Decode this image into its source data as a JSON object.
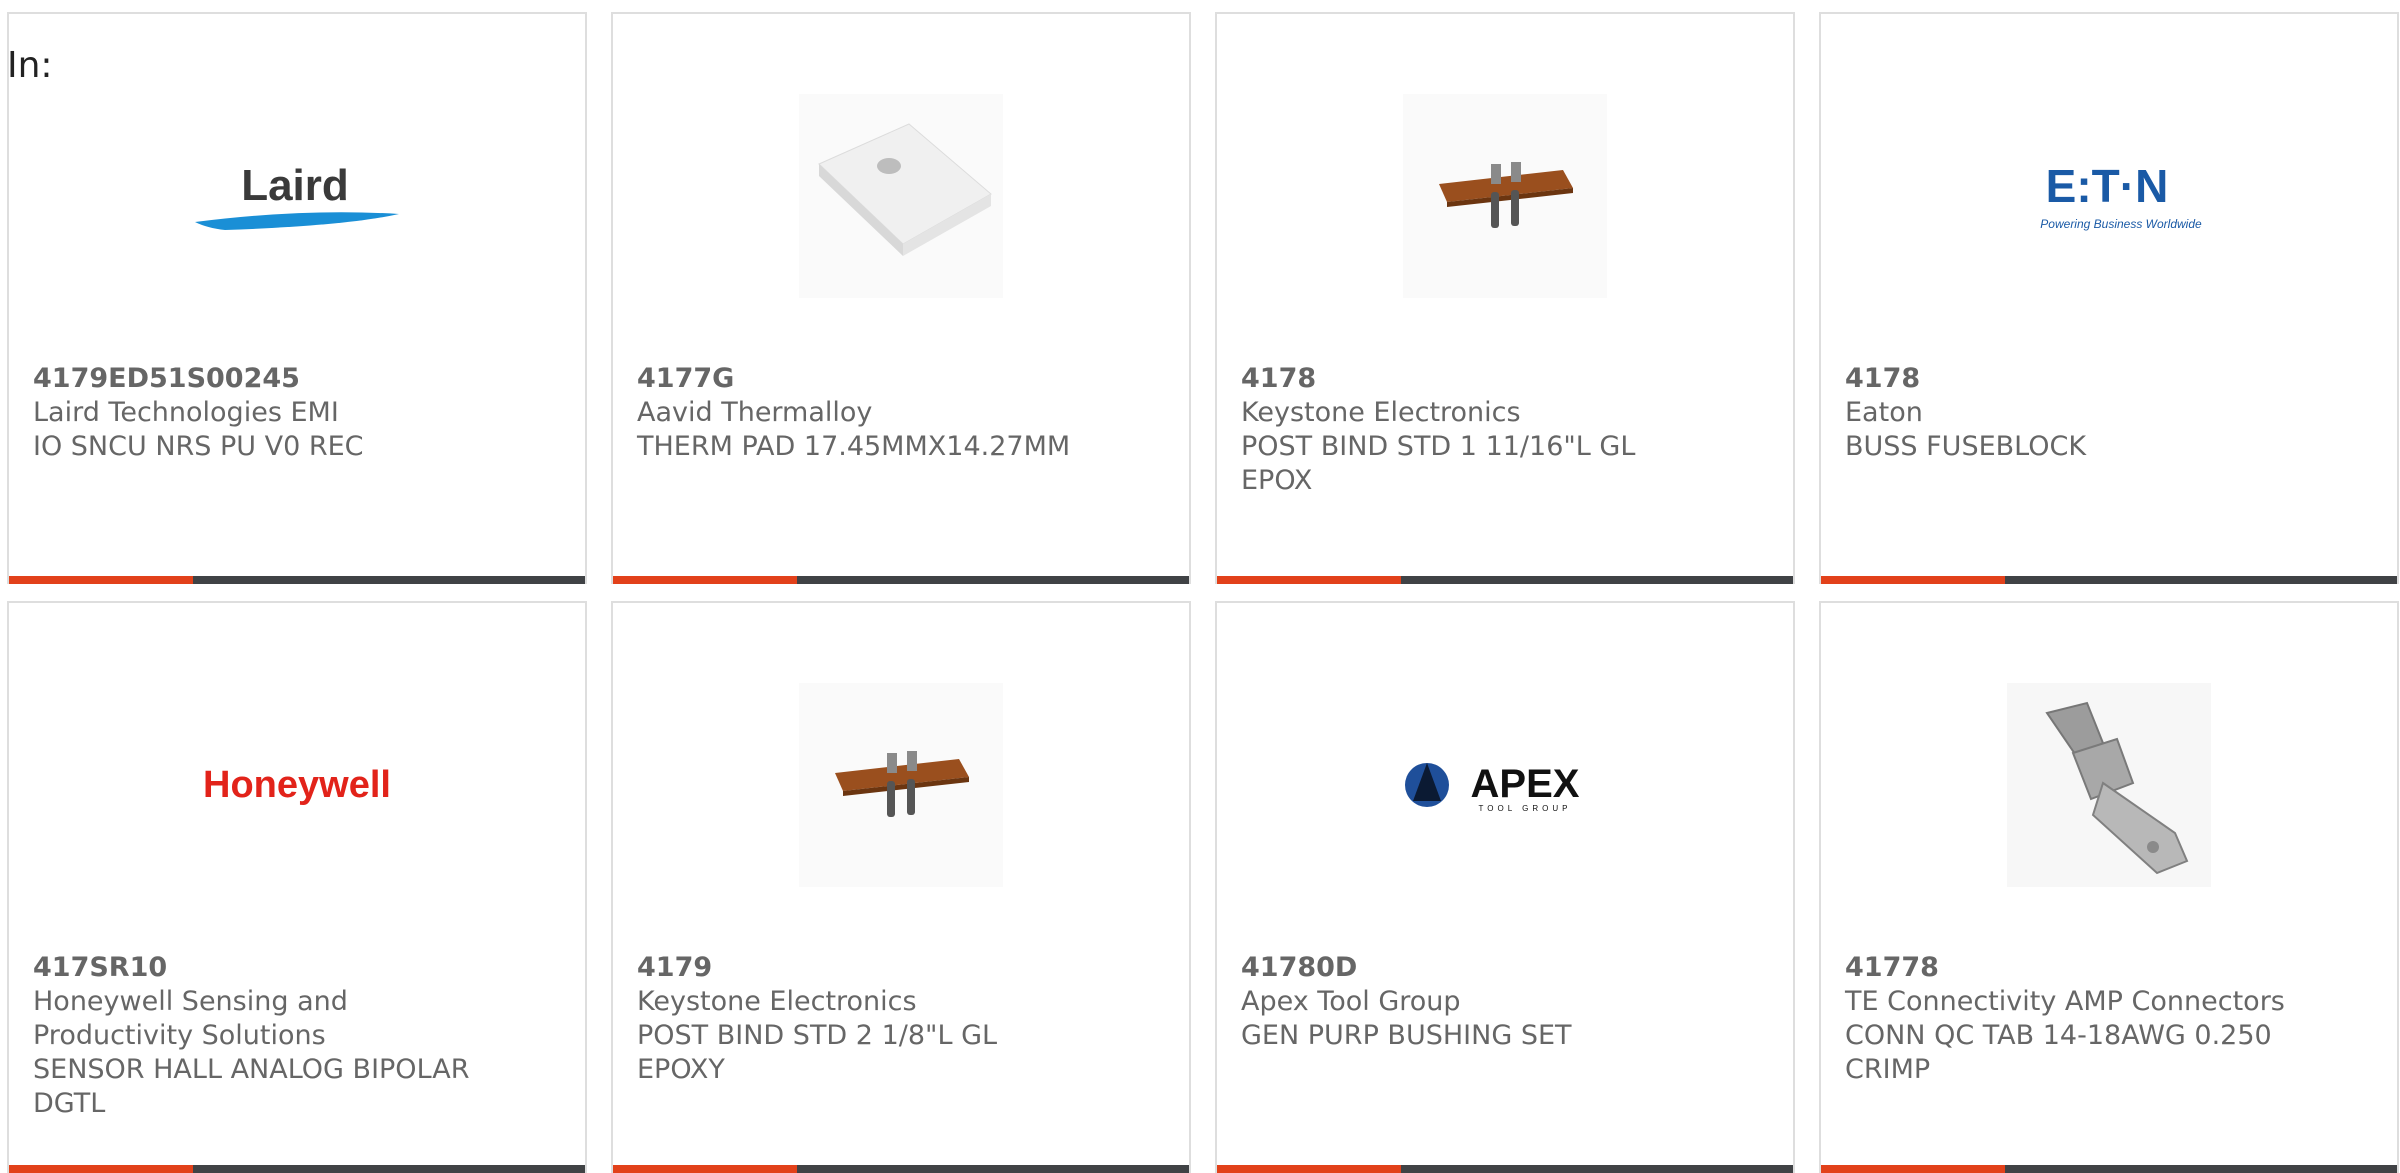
{
  "filter_label": "In:",
  "colors": {
    "accent": "#e2411a",
    "dark_bar": "#404245",
    "text": "#666666"
  },
  "cards": [
    {
      "part_number": "4179ED51S00245",
      "manufacturer": "Laird Technologies EMI",
      "description": "IO SNCU NRS PU V0 REC",
      "image": "laird-logo",
      "logo_text": "Laird"
    },
    {
      "part_number": "4177G",
      "manufacturer": "Aavid Thermalloy",
      "description": "THERM PAD 17.45MMX14.27MM",
      "image": "thermal-pad-photo"
    },
    {
      "part_number": "4178",
      "manufacturer": "Keystone Electronics",
      "description": "POST BIND STD 1 11/16\"L GL\nEPOX",
      "image": "binding-post-photo"
    },
    {
      "part_number": "4178",
      "manufacturer": "Eaton",
      "description": "BUSS FUSEBLOCK",
      "image": "eaton-logo",
      "logo_text": "E:T·N",
      "logo_tagline": "Powering Business Worldwide"
    },
    {
      "part_number": "417SR10",
      "manufacturer": "Honeywell Sensing and\nProductivity Solutions",
      "description": "SENSOR HALL ANALOG BIPOLAR\nDGTL",
      "image": "honeywell-logo",
      "logo_text": "Honeywell"
    },
    {
      "part_number": "4179",
      "manufacturer": "Keystone Electronics",
      "description": "POST BIND STD 2 1/8\"L GL\nEPOXY",
      "image": "binding-post-photo"
    },
    {
      "part_number": "41780D",
      "manufacturer": "Apex Tool Group",
      "description": "GEN PURP BUSHING SET",
      "image": "apex-logo",
      "logo_text": "APEX",
      "logo_tagline": "TOOL GROUP"
    },
    {
      "part_number": "41778",
      "manufacturer": "TE Connectivity AMP Connectors",
      "description": "CONN QC TAB 14-18AWG 0.250\nCRIMP",
      "image": "qc-tab-photo"
    }
  ]
}
